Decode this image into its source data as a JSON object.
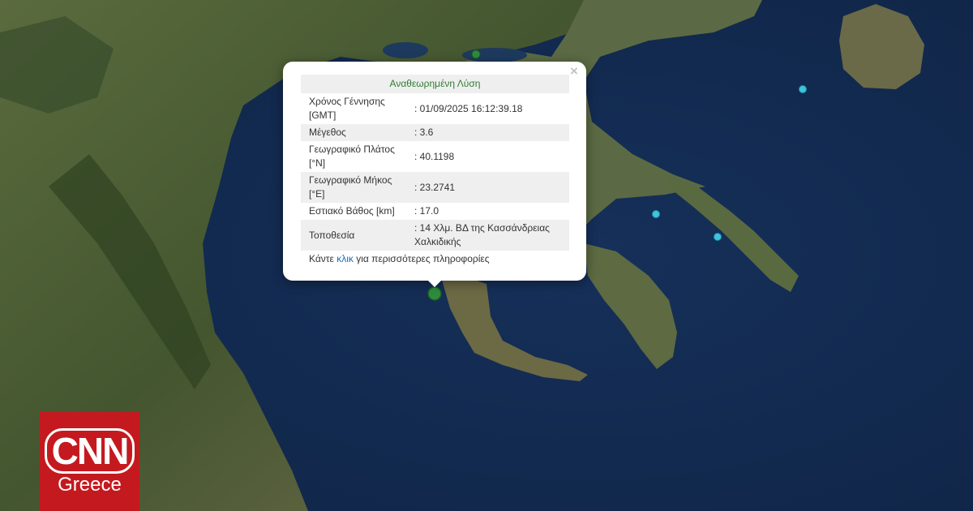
{
  "popup": {
    "header": "Αναθεωρημένη Λύση",
    "rows": [
      {
        "label": "Χρόνος Γέννησης [GMT]",
        "value": ": 01/09/2025 16:12:39.18"
      },
      {
        "label": "Μέγεθος",
        "value": ": 3.6"
      },
      {
        "label": "Γεωγραφικό Πλάτος [°N]",
        "value": ": 40.1198"
      },
      {
        "label": "Γεωγραφικό Μήκος [°E]",
        "value": ": 23.2741"
      },
      {
        "label": "Εστιακό Βάθος [km]",
        "value": ": 17.0"
      },
      {
        "label": "Τοποθεσία",
        "value": ": 14 Χλμ. ΒΔ της Κασσάνδρειας Χαλκιδικής"
      }
    ],
    "more_prefix": "Κάντε ",
    "more_link": "κλικ",
    "more_suffix": " για περισσότερες πληροφορίες",
    "close_symbol": "×"
  },
  "logo": {
    "line1": "CNN",
    "line2": "Greece"
  },
  "colors": {
    "sea": "#132a4d",
    "land": "#4a5a35",
    "event_main": "#2e8b3e",
    "event_other": "#3ec4dc",
    "popup_header": "#2e7d32",
    "link": "#1a6fb8",
    "logo_bg": "#c41a1f"
  }
}
